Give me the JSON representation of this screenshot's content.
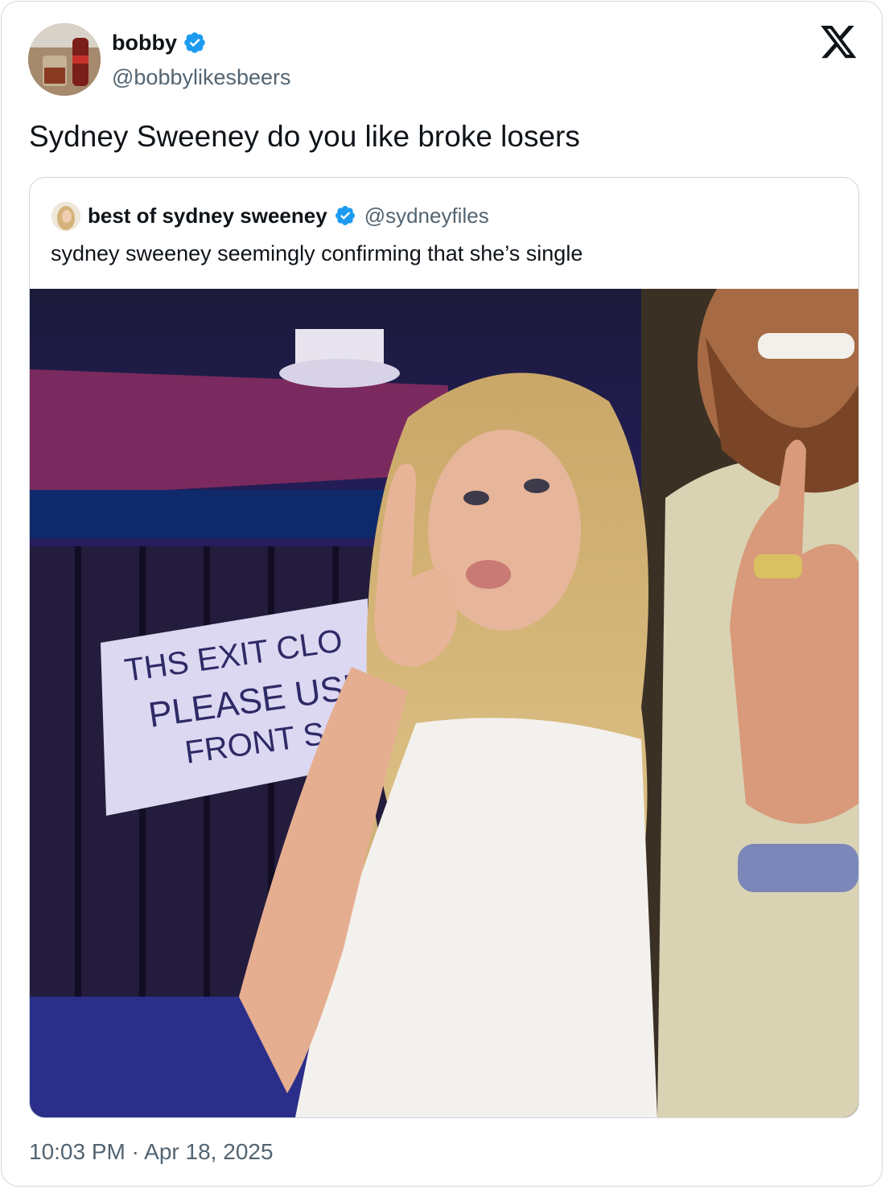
{
  "tweet": {
    "author": {
      "display_name": "bobby",
      "handle": "@bobbylikesbeers",
      "verified": true,
      "avatar_icon": "avatar-photo"
    },
    "text": "Sydney Sweeney do you like broke losers",
    "timestamp": "10:03 PM · Apr 18, 2025",
    "platform_icon": "x-logo-icon"
  },
  "quoted_tweet": {
    "author": {
      "display_name": "best of sydney sweeney",
      "handle": "@sydneyfiles",
      "verified": true
    },
    "text": "sydney sweeney seemingly confirming that she’s single",
    "photo": {
      "sign_lines": [
        "THS EXIT CLO",
        "PLEASE USE",
        "FRONT S"
      ]
    }
  },
  "colors": {
    "verified_blue": "#1d9bf0",
    "text_primary": "#0f1419",
    "text_secondary": "#536471",
    "border": "#cfd9de"
  }
}
